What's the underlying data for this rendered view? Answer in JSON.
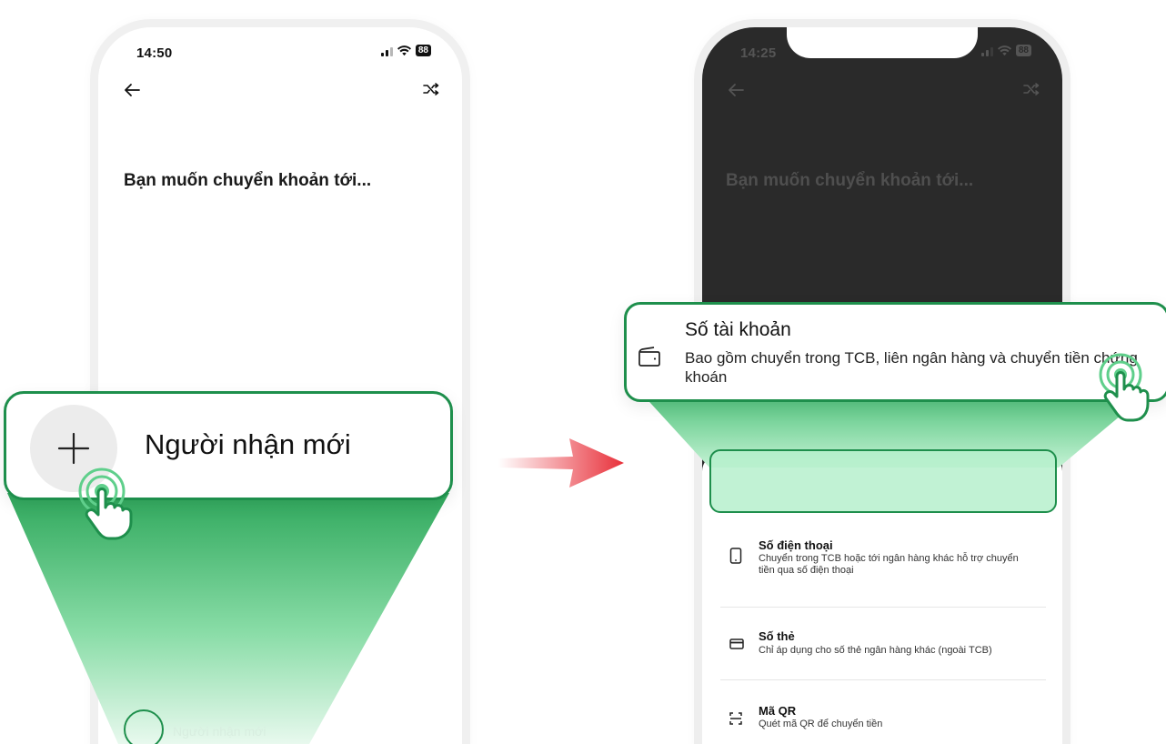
{
  "left_phone": {
    "status_time": "14:50",
    "battery": "88",
    "heading": "Bạn muốn chuyển khoản tới...",
    "callout_label": "Người nhận mới",
    "bottom_label": "Người nhận mới"
  },
  "right_phone": {
    "status_time": "14:25",
    "battery": "88",
    "heading": "Bạn muốn chuyển khoản tới...",
    "callout_title": "Số tài khoản",
    "callout_desc": "Bao gồm chuyển trong TCB, liên ngân hàng và chuyển tiền chứng khoán",
    "options": [
      {
        "title": "Số điện thoại",
        "desc": "Chuyển trong TCB hoặc tới ngân hàng khác hỗ trợ chuyển tiền qua số điện thoại",
        "icon": "phone-icon"
      },
      {
        "title": "Số thẻ",
        "desc": "Chỉ áp dụng cho số thẻ ngân hàng khác (ngoài TCB)",
        "icon": "card-icon"
      },
      {
        "title": "Mã QR",
        "desc": "Quét mã QR để chuyển tiền",
        "icon": "qr-scan-icon"
      }
    ]
  },
  "colors": {
    "accent_green": "#1e8f4c",
    "funnel_green": "#3dbb6d",
    "arrow_red": "#e8303a",
    "dark_overlay": "#2a2a2a"
  }
}
